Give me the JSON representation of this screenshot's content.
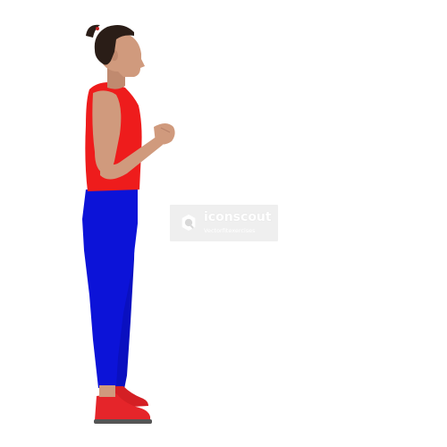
{
  "watermark": {
    "brand": "iconscout",
    "author": "Vectorfitexercises"
  },
  "illustration": {
    "subject": "person-standing-side-view",
    "colors": {
      "skin": "#d09a7d",
      "hair": "#2a1d17",
      "tank_top": "#ee1c1c",
      "leggings": "#0c13d8",
      "shoes": "#e5252a",
      "shoe_sole": "#555555",
      "background": "#ffffff"
    },
    "icons": [
      "iconscout-logo-icon"
    ]
  }
}
